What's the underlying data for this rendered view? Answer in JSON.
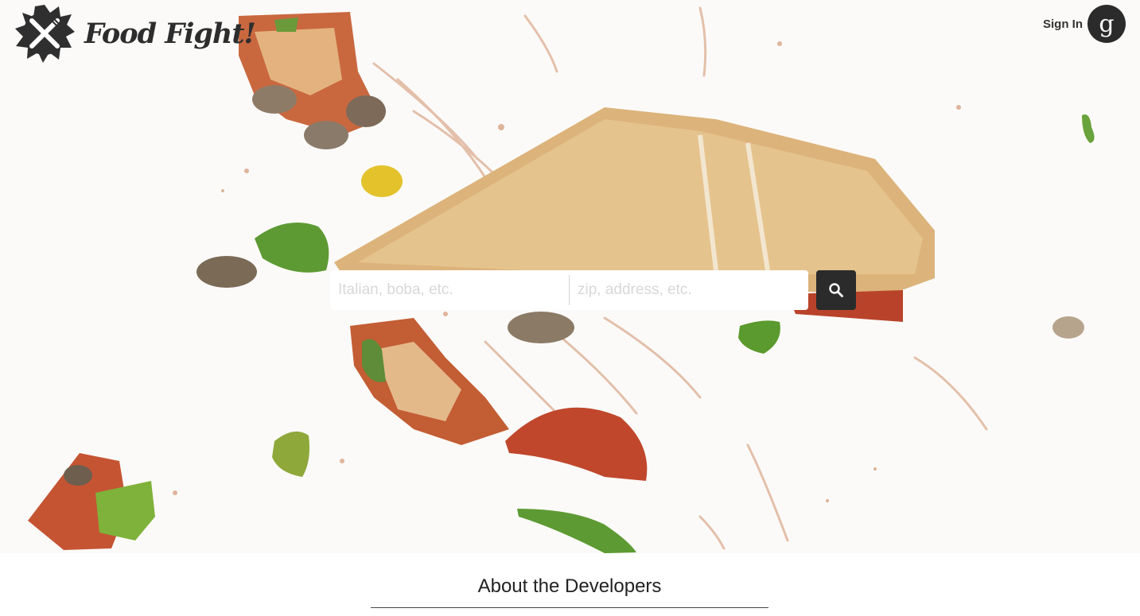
{
  "app": {
    "title": "Food Fight!",
    "logo_icon": "fork-knife-splat-icon"
  },
  "header": {
    "signin_label": "Sign In",
    "google_glyph": "g",
    "google_icon": "google-icon"
  },
  "search": {
    "food_placeholder": "Italian, boba, etc.",
    "food_value": "",
    "location_placeholder": "zip, address, etc.",
    "location_value": "",
    "button_icon": "search-icon"
  },
  "about": {
    "title": "About the Developers"
  },
  "colors": {
    "dark": "#2b2b2b",
    "background": "#ffffff"
  }
}
